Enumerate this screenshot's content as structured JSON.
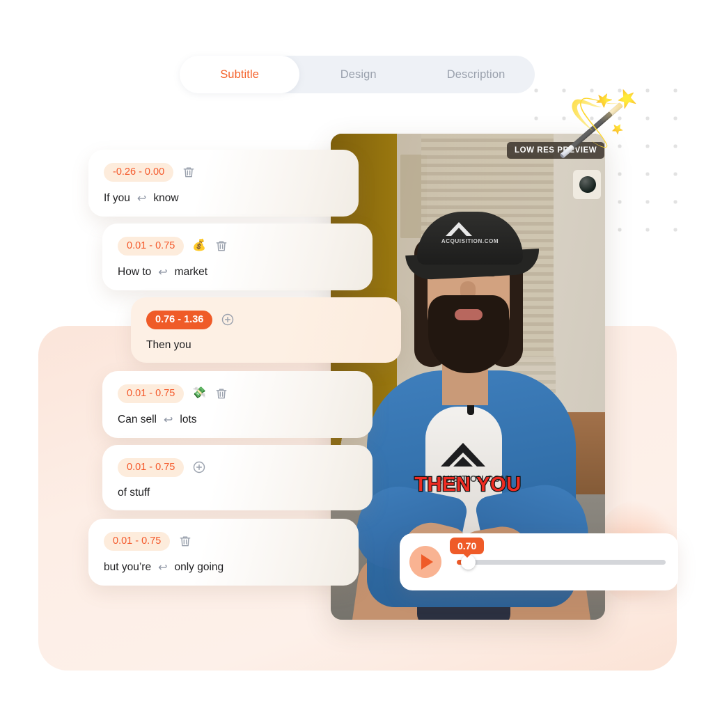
{
  "tabs": [
    {
      "label": "Subtitle",
      "active": true
    },
    {
      "label": "Design",
      "active": false
    },
    {
      "label": "Description",
      "active": false
    }
  ],
  "subtitle_cards": [
    {
      "time_range": "-0.26 - 0.00",
      "text_left": "If you",
      "wrap_glyph": "↩",
      "text_right": "know",
      "emoji": "",
      "action": "delete",
      "active": false
    },
    {
      "time_range": "0.01 - 0.75",
      "text_left": "How to",
      "wrap_glyph": "↩",
      "text_right": "market",
      "emoji": "💰",
      "action": "delete",
      "active": false
    },
    {
      "time_range": "0.76 - 1.36",
      "text_left": "Then you",
      "wrap_glyph": "",
      "text_right": "",
      "emoji": "",
      "action": "add",
      "active": true
    },
    {
      "time_range": "0.01 - 0.75",
      "text_left": "Can sell",
      "wrap_glyph": "↩",
      "text_right": "lots",
      "emoji": "💸",
      "action": "delete",
      "active": false
    },
    {
      "time_range": "0.01 - 0.75",
      "text_left": "of stuff",
      "wrap_glyph": "",
      "text_right": "",
      "emoji": "",
      "action": "add",
      "active": false
    },
    {
      "time_range": "0.01 - 0.75",
      "text_left": "but you’re",
      "wrap_glyph": "↩",
      "text_right": "only going",
      "emoji": "",
      "action": "delete",
      "active": false
    }
  ],
  "preview": {
    "low_res_label": "LOW RES PREVIEW",
    "wand_emoji": "🪄",
    "burned_caption": "THEN YOU",
    "cap_logo_text": "ACQUISITION.COM",
    "shirt_logo_text": "QUISITION.COM"
  },
  "player": {
    "current_time": "0.70",
    "play_icon": "play-icon",
    "progress_percent": 2
  },
  "colors": {
    "accent": "#ef5b28",
    "accent_text": "#f4582a",
    "badge_bg": "#fdecdc",
    "tabbar_bg": "#eef1f6",
    "peach_panel": "#fbe5da",
    "caption_red": "#ef2b22"
  }
}
